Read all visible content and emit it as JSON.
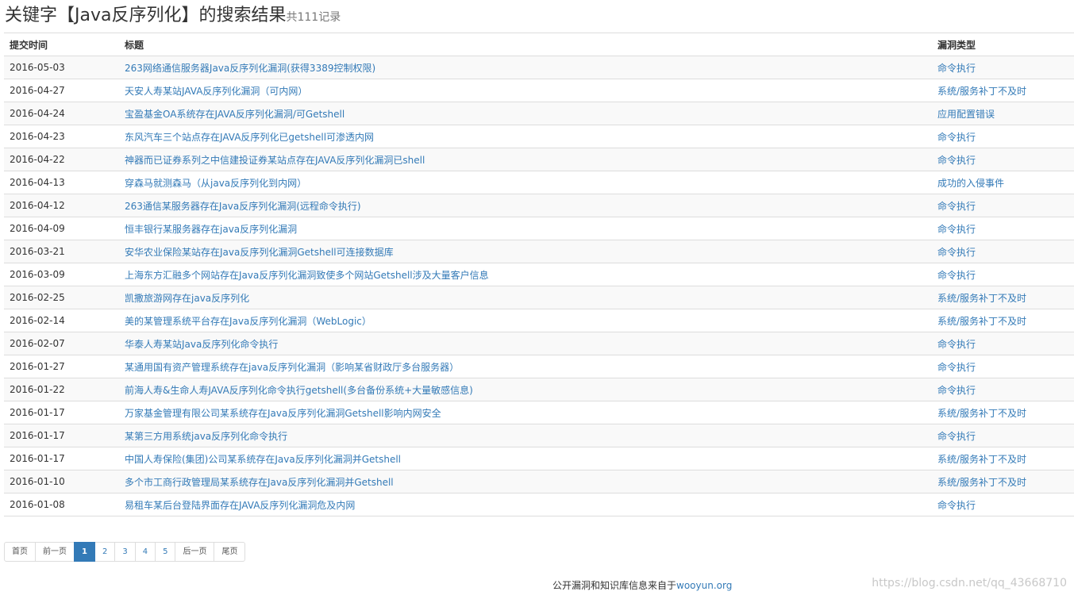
{
  "heading": {
    "title": "关键字【Java反序列化】的搜索结果",
    "count": "共111记录"
  },
  "table": {
    "headers": {
      "date": "提交时间",
      "title": "标题",
      "type": "漏洞类型"
    },
    "rows": [
      {
        "date": "2016-05-03",
        "title": "263网络通信服务器Java反序列化漏洞(获得3389控制权限)",
        "type": "命令执行"
      },
      {
        "date": "2016-04-27",
        "title": "天安人寿某站JAVA反序列化漏洞（可内网）",
        "type": "系统/服务补丁不及时"
      },
      {
        "date": "2016-04-24",
        "title": "宝盈基金OA系统存在JAVA反序列化漏洞/可Getshell",
        "type": "应用配置错误"
      },
      {
        "date": "2016-04-23",
        "title": "东风汽车三个站点存在JAVA反序列化已getshell可渗透内网",
        "type": "命令执行"
      },
      {
        "date": "2016-04-22",
        "title": "神器而已证券系列之中信建投证券某站点存在JAVA反序列化漏洞已shell",
        "type": "命令执行"
      },
      {
        "date": "2016-04-13",
        "title": "穿森马就测森马（从java反序列化到内网）",
        "type": "成功的入侵事件"
      },
      {
        "date": "2016-04-12",
        "title": "263通信某服务器存在Java反序列化漏洞(远程命令执行)",
        "type": "命令执行"
      },
      {
        "date": "2016-04-09",
        "title": "恒丰银行某服务器存在java反序列化漏洞",
        "type": "命令执行"
      },
      {
        "date": "2016-03-21",
        "title": "安华农业保险某站存在Java反序列化漏洞Getshell可连接数据库",
        "type": "命令执行"
      },
      {
        "date": "2016-03-09",
        "title": "上海东方汇融多个网站存在Java反序列化漏洞致使多个网站Getshell涉及大量客户信息",
        "type": "命令执行"
      },
      {
        "date": "2016-02-25",
        "title": "凯撒旅游网存在java反序列化",
        "type": "系统/服务补丁不及时"
      },
      {
        "date": "2016-02-14",
        "title": "美的某管理系统平台存在Java反序列化漏洞（WebLogic）",
        "type": "系统/服务补丁不及时"
      },
      {
        "date": "2016-02-07",
        "title": "华泰人寿某站Java反序列化命令执行",
        "type": "命令执行"
      },
      {
        "date": "2016-01-27",
        "title": "某通用国有资产管理系统存在java反序列化漏洞（影响某省财政厅多台服务器）",
        "type": "命令执行"
      },
      {
        "date": "2016-01-22",
        "title": "前海人寿&生命人寿JAVA反序列化命令执行getshell(多台备份系统+大量敏感信息)",
        "type": "命令执行"
      },
      {
        "date": "2016-01-17",
        "title": "万家基金管理有限公司某系统存在Java反序列化漏洞Getshell影响内网安全",
        "type": "系统/服务补丁不及时"
      },
      {
        "date": "2016-01-17",
        "title": "某第三方用系统java反序列化命令执行",
        "type": "命令执行"
      },
      {
        "date": "2016-01-17",
        "title": "中国人寿保险(集团)公司某系统存在Java反序列化漏洞并Getshell",
        "type": "系统/服务补丁不及时"
      },
      {
        "date": "2016-01-10",
        "title": "多个市工商行政管理局某系统存在Java反序列化漏洞并Getshell",
        "type": "系统/服务补丁不及时"
      },
      {
        "date": "2016-01-08",
        "title": "易租车某后台登陆界面存在JAVA反序列化漏洞危及内网",
        "type": "命令执行"
      }
    ]
  },
  "pagination": {
    "first": "首页",
    "prev": "前一页",
    "pages": [
      "1",
      "2",
      "3",
      "4",
      "5"
    ],
    "current": "1",
    "next": "后一页",
    "last": "尾页"
  },
  "footer": {
    "text": "公开漏洞和知识库信息来自于",
    "link": "wooyun.org"
  },
  "watermark": "https://blog.csdn.net/qq_43668710",
  "colors": {
    "link": "#337ab7",
    "active_page_bg": "#337ab7",
    "stripe": "#f9f9f9",
    "border": "#dddddd"
  }
}
